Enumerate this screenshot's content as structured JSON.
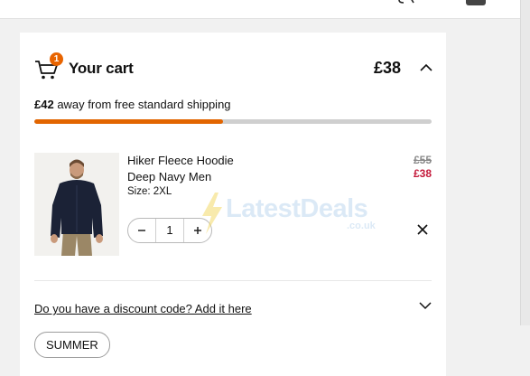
{
  "cart": {
    "title": "Your cart",
    "item_count": "1",
    "total": "£38"
  },
  "shipping": {
    "amount": "£42",
    "message": " away from free standard shipping",
    "progress_fraction": 0.475
  },
  "item": {
    "name": "Hiker Fleece Hoodie Deep Navy Men",
    "size": "Size: 2XL",
    "price_old": "£55",
    "price_new": "£38",
    "quantity": "1"
  },
  "discount": {
    "link_text": "Do you have a discount code? Add it here",
    "code": "SUMMER"
  },
  "watermark": {
    "text": "LatestDeals",
    "sub": ".co.uk"
  },
  "colors": {
    "accent": "#e26500",
    "sale": "#c41a3b"
  }
}
